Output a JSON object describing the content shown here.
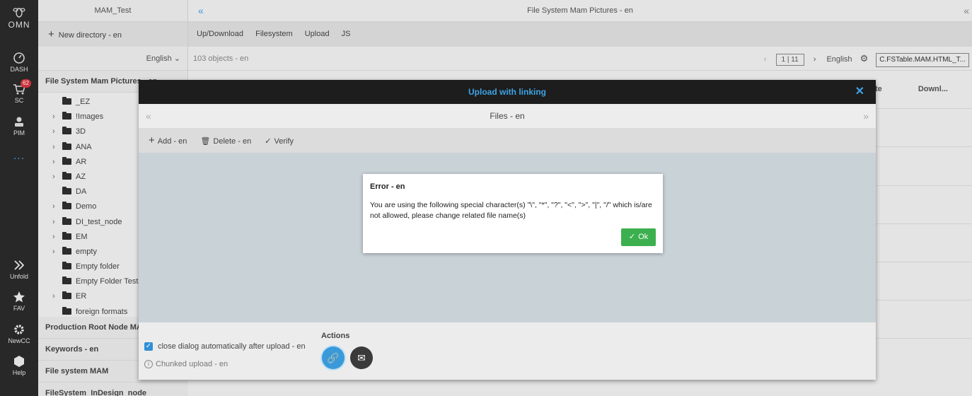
{
  "rail": {
    "logo": "OMN",
    "items": [
      {
        "label": "DASH",
        "icon": "dashboard-icon"
      },
      {
        "label": "SC",
        "icon": "cart-icon",
        "badge": "62"
      },
      {
        "label": "PIM",
        "icon": "pim-icon"
      },
      {
        "label": "...",
        "icon": "more-icon"
      },
      {
        "label": "Unfold",
        "icon": "unfold-icon"
      },
      {
        "label": "FAV",
        "icon": "star-icon"
      },
      {
        "label": "NewCC",
        "icon": "gear-icon"
      },
      {
        "label": "Help",
        "icon": "help-icon"
      }
    ]
  },
  "tree": {
    "header": "MAM_Test",
    "new_directory": "New directory - en",
    "language": "English",
    "section_title": "File System Mam Pictures - en",
    "nodes": [
      {
        "label": "_EZ",
        "expandable": false
      },
      {
        "label": "!Images",
        "expandable": true
      },
      {
        "label": "3D",
        "expandable": true
      },
      {
        "label": "ANA",
        "expandable": true
      },
      {
        "label": "AR",
        "expandable": true
      },
      {
        "label": "AZ",
        "expandable": true
      },
      {
        "label": "DA",
        "expandable": false
      },
      {
        "label": "Demo",
        "expandable": true
      },
      {
        "label": "DI_test_node",
        "expandable": true
      },
      {
        "label": "EM",
        "expandable": true
      },
      {
        "label": "empty",
        "expandable": true
      },
      {
        "label": "Empty folder",
        "expandable": false
      },
      {
        "label": "Empty Folder Test",
        "expandable": false
      },
      {
        "label": "ER",
        "expandable": true
      },
      {
        "label": "foreign formats",
        "expandable": false
      }
    ],
    "sections": [
      "Production Root Node MAM",
      "Keywords - en",
      "File system MAM",
      "FileSystem_InDesign_node"
    ]
  },
  "main": {
    "title": "File System Mam Pictures - en",
    "menus": [
      "Up/Download",
      "Filesystem",
      "Upload",
      "JS"
    ],
    "object_count": "103 objects - en",
    "pager": "1 | 11",
    "language": "English",
    "view_select": "C.FSTable.MAM.HTML_T...",
    "col_heads": [
      "te",
      "Downl..."
    ]
  },
  "upload_dialog": {
    "title": "Upload with linking",
    "subtitle": "Files - en",
    "toolbar": {
      "add": "Add - en",
      "delete": "Delete - en",
      "verify": "Verify"
    },
    "close_option": "close dialog automatically after upload - en",
    "close_option_checked": true,
    "chunked": "Chunked upload - en",
    "actions_label": "Actions"
  },
  "error_dialog": {
    "title": "Error - en",
    "message": "You are using the following special character(s) \"\\\", \"*\", \"?\", \"<\", \">\", \"|\", \"/\" which is/are not allowed, please change related file name(s)",
    "ok": "Ok"
  },
  "colors": {
    "accent": "#3ea3e6",
    "ok_green": "#3cb04f",
    "badge_red": "#d9363e"
  }
}
